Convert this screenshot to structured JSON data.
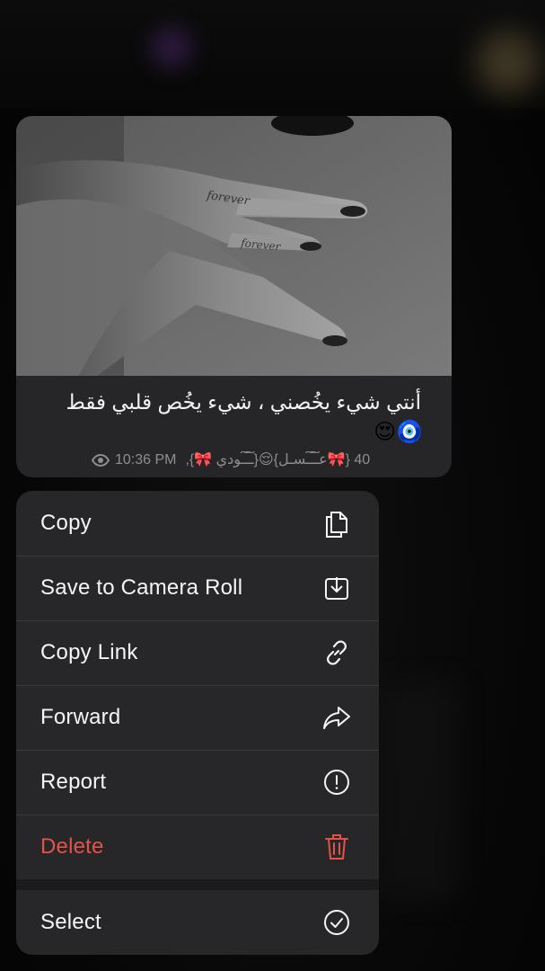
{
  "message": {
    "caption": "أنتي شيء يخُصني ، شيء يخُص قلبي فقط",
    "caption_emojis": "🧿😍",
    "time": "10:36 PM",
    "reactions_text": "40 {🎀عـ͠ـ͠ـسـل}😌{ـ͠ـ͠ـودي 🎀},",
    "views_icon": "eye-icon"
  },
  "menu": {
    "items": [
      {
        "label": "Copy",
        "icon": "copy-icon"
      },
      {
        "label": "Save to Camera Roll",
        "icon": "download-icon"
      },
      {
        "label": "Copy Link",
        "icon": "link-icon"
      },
      {
        "label": "Forward",
        "icon": "forward-icon"
      },
      {
        "label": "Report",
        "icon": "report-icon"
      },
      {
        "label": "Delete",
        "icon": "trash-icon",
        "color": "#e5524a"
      },
      {
        "label": "Select",
        "icon": "check-circle-icon"
      }
    ]
  },
  "colors": {
    "menu_bg": "#272729",
    "bubble_bg": "#262628",
    "danger": "#e5524a",
    "text": "#f5f5f7",
    "meta": "#8e8e92"
  }
}
